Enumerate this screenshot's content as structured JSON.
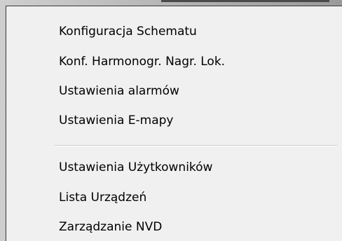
{
  "context_menu": {
    "group1": [
      {
        "label": "Konfiguracja Schematu"
      },
      {
        "label": "Konf. Harmonogr. Nagr. Lok."
      },
      {
        "label": "Ustawienia alarmów"
      },
      {
        "label": "Ustawienia E-mapy"
      }
    ],
    "group2": [
      {
        "label": "Ustawienia Użytkowników"
      },
      {
        "label": "Lista Urządzeń"
      },
      {
        "label": "Zarządzanie NVD"
      }
    ]
  },
  "colors": {
    "menu_background": "#f0f0f0",
    "menu_border": "#3c3c3c",
    "separator": "#d0d0d0",
    "text": "#000000"
  }
}
